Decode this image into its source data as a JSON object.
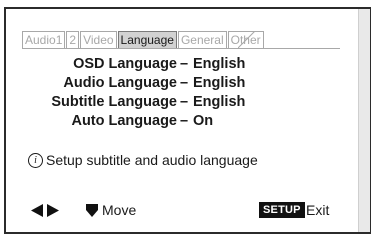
{
  "tabs": [
    {
      "label": "Audio1",
      "active": false
    },
    {
      "label": "2",
      "active": false
    },
    {
      "label": "Video",
      "active": false
    },
    {
      "label": "Language",
      "active": true
    },
    {
      "label": "General",
      "active": false
    },
    {
      "label": "Other",
      "active": false
    }
  ],
  "settings": [
    {
      "label": "OSD Language",
      "value": "English"
    },
    {
      "label": "Audio Language",
      "value": "English"
    },
    {
      "label": "Subtitle Language",
      "value": "English"
    },
    {
      "label": "Auto Language",
      "value": "On"
    }
  ],
  "separator": "–",
  "help_text": "Setup subtitle and audio language",
  "help_icon": "i",
  "footer": {
    "navigate_icon": "left-right-arrows-icon",
    "move_icon": "down-arrow-icon",
    "move_label": "Move",
    "setup_badge": "SETUP",
    "exit_label": "Exit"
  },
  "colors": {
    "active_tab": "#d2d2d2",
    "inactive_tab_text": "#a8a8a8",
    "text": "#1a1a1a",
    "badge_bg": "#111111"
  }
}
